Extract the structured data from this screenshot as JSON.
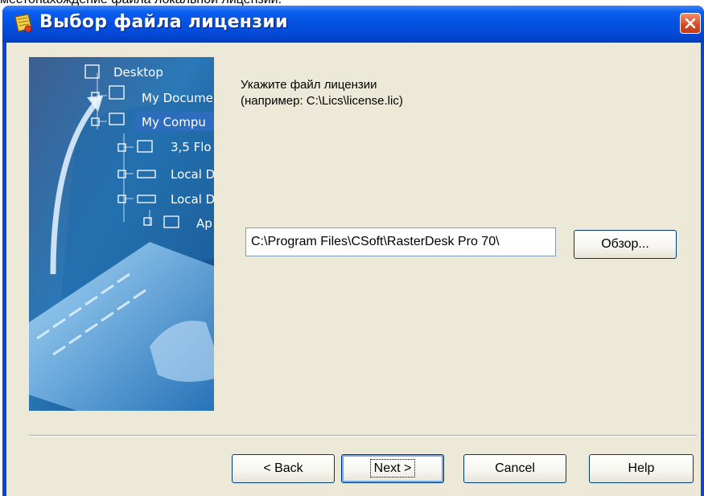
{
  "background_caption": "местонахождение файла локальной лицензии.",
  "window": {
    "title": "Выбор файла лицензии"
  },
  "side_image": {
    "tree_items": [
      "Desktop",
      "My Docume",
      "My Compu",
      "3,5 Flo",
      "Local D",
      "Local D",
      "Ap"
    ]
  },
  "instruction": {
    "line1": "Укажите файл лицензии",
    "line2": "(например: C:\\Lics\\license.lic)"
  },
  "path_field": {
    "value": "C:\\Program Files\\CSoft\\RasterDesk Pro 70\\"
  },
  "buttons": {
    "browse": "Обзор...",
    "back": "< Back",
    "next": "Next >",
    "cancel": "Cancel",
    "help": "Help"
  },
  "colors": {
    "titlebar": "#0451e0",
    "client": "#ece9d8",
    "close": "#d44a24"
  },
  "icons": [
    "app-license-icon",
    "close-icon"
  ]
}
